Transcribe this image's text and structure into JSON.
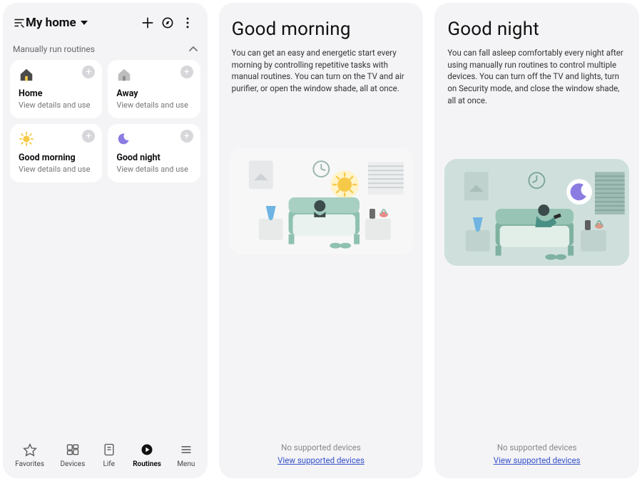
{
  "panel1": {
    "home_label": "My home",
    "section_label": "Manually run routines",
    "cards": [
      {
        "name": "Home",
        "sub": "View details and use"
      },
      {
        "name": "Away",
        "sub": "View details and use"
      },
      {
        "name": "Good morning",
        "sub": "View details and use"
      },
      {
        "name": "Good night",
        "sub": "View details and use"
      }
    ],
    "nav": {
      "favorites": "Favorites",
      "devices": "Devices",
      "life": "Life",
      "routines": "Routines",
      "menu": "Menu"
    }
  },
  "panel2": {
    "title": "Good morning",
    "desc": "You can get an easy and energetic start every morning by controlling repetitive tasks with manual routines. You can turn on the TV and air purifier, or open the window shade, all at once.",
    "no_supported": "No supported devices",
    "view_link": "View supported devices"
  },
  "panel3": {
    "title": "Good night",
    "desc": "You can fall asleep comfortably every night after using manually run routines to control multiple devices. You can turn off the TV and lights, turn on Security mode, and close the window shade, all at once.",
    "no_supported": "No supported devices",
    "view_link": "View supported devices"
  }
}
